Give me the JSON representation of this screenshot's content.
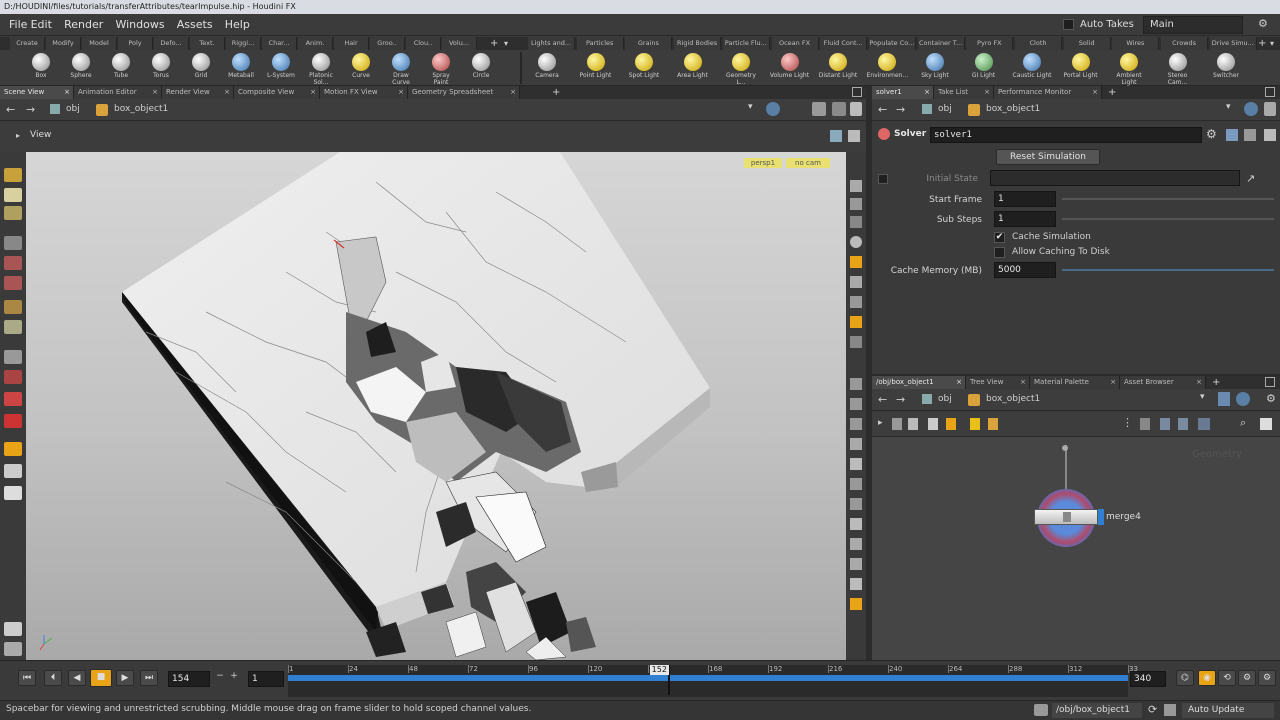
{
  "window": {
    "title": "D:/HOUDINI/files/tutorials/transferAttributes/tearImpulse.hip - Houdini FX"
  },
  "menubar": {
    "items": [
      "File",
      "Edit",
      "Render",
      "Windows",
      "Assets",
      "Help"
    ],
    "auto_takes": "Auto Takes",
    "desktop": "Main"
  },
  "shelf_left": {
    "tabs": [
      "Create",
      "Modify",
      "Model",
      "Poly",
      "Defo...",
      "Text.",
      "Riggi...",
      "Char...",
      "Anim.",
      "Hair",
      "Groo..",
      "Clou..",
      "Volu..."
    ],
    "tools": [
      "Box",
      "Sphere",
      "Tube",
      "Torus",
      "Grid",
      "Metaball",
      "L-System",
      "Platonic Sol...",
      "Curve",
      "Draw Curve",
      "Spray Paint",
      "Circle"
    ]
  },
  "shelf_right": {
    "tabs": [
      "Lights and...",
      "Particles",
      "Grains",
      "Rigid Bodies",
      "Particle Flu...",
      "Ocean FX",
      "Fluid Cont...",
      "Populate Co...",
      "Container T...",
      "Pyro FX",
      "Cloth",
      "Solid",
      "Wires",
      "Crowds",
      "Drive Simu..."
    ],
    "tools": [
      "Camera",
      "Point Light",
      "Spot Light",
      "Area Light",
      "Geometry L...",
      "Volume Light",
      "Distant Light",
      "Environmen...",
      "Sky Light",
      "GI Light",
      "Caustic Light",
      "Portal Light",
      "Ambient Light",
      "Stereo Cam...",
      "Switcher"
    ]
  },
  "scene_panel": {
    "tabs": [
      "Scene View",
      "Animation Editor",
      "Render View",
      "Composite View",
      "Motion FX View",
      "Geometry Spreadsheet"
    ],
    "path_root": "obj",
    "path_node": "box_object1",
    "view_label": "View",
    "persp_label": "persp1",
    "cam_label": "no cam"
  },
  "parm_panel": {
    "tabs": [
      "solver1",
      "Take List",
      "Performance Monitor"
    ],
    "path_root": "obj",
    "path_node": "box_object1",
    "node_type": "Solver",
    "node_name": "solver1",
    "reset_button": "Reset Simulation",
    "initial_state_label": "Initial State",
    "start_frame_label": "Start Frame",
    "start_frame_value": "1",
    "sub_steps_label": "Sub Steps",
    "sub_steps_value": "1",
    "cache_sim_label": "Cache Simulation",
    "cache_sim_checked": true,
    "allow_cache_label": "Allow Caching To Disk",
    "allow_cache_checked": false,
    "cache_mem_label": "Cache Memory (MB)",
    "cache_mem_value": "5000"
  },
  "network_panel": {
    "tabs": [
      "/obj/box_object1",
      "Tree View",
      "Material Palette",
      "Asset Browser"
    ],
    "path_root": "obj",
    "path_node": "box_object1",
    "watermark": "Geometry",
    "node_label": "merge4"
  },
  "timeline": {
    "current_frame": "154",
    "step": "1",
    "start_frame": "1",
    "end_frame": "340",
    "slider_frame": "152",
    "ticks": [
      "1",
      "24",
      "48",
      "72",
      "96",
      "120",
      "144",
      "168",
      "192",
      "216",
      "240",
      "264",
      "288",
      "312",
      "33"
    ],
    "playhead_fraction": 0.452,
    "auto_update": "Auto Update",
    "obj_path": "/obj/box_object1"
  },
  "status": {
    "message": "Spacebar for viewing and unrestricted scrubbing. Middle mouse drag on frame slider to hold scoped channel values."
  },
  "colors": {
    "accent": "#e8a317",
    "timeline_blue": "#2f7fd3",
    "node_ring": "#4a74c9"
  }
}
